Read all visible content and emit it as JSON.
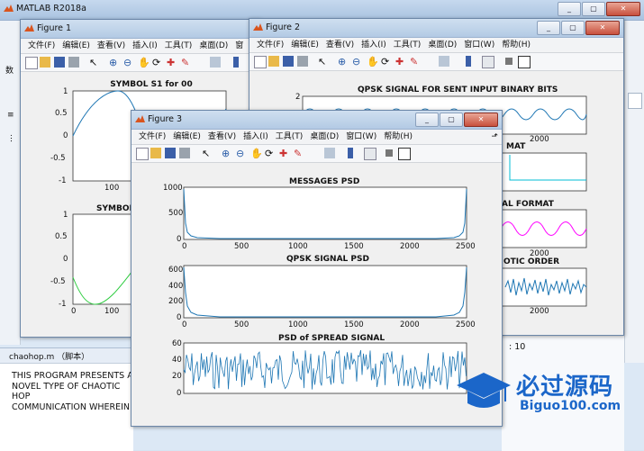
{
  "matlab": {
    "title": "MATLAB R2018a",
    "file_panel_title": "chaohop.m （脚本）",
    "file_text": [
      "THIS PROGRAM PRESENTS A",
      "NOVEL TYPE OF CHAOTIC HOP",
      "COMMUNICATION WHEREIN"
    ],
    "side_letter": "数",
    "right_value": ": 10"
  },
  "menus": {
    "fig1": [
      "文件(F)",
      "编辑(E)",
      "查看(V)",
      "插入(I)",
      "工具(T)",
      "桌面(D)",
      "窗"
    ],
    "fig2": [
      "文件(F)",
      "编辑(E)",
      "查看(V)",
      "插入(I)",
      "工具(T)",
      "桌面(D)",
      "窗口(W)",
      "帮助(H)"
    ],
    "fig3": [
      "文件(F)",
      "编辑(E)",
      "查看(V)",
      "插入(I)",
      "工具(T)",
      "桌面(D)",
      "窗口(W)",
      "帮助(H)"
    ]
  },
  "fig1": {
    "title": "Figure 1",
    "plot1": {
      "title": "SYMBOL S1 for 00",
      "yticks": [
        "1",
        "0.5",
        "0",
        "-0.5",
        "-1"
      ],
      "xticks": [
        "100"
      ]
    },
    "plot2": {
      "title": "SYMBOL",
      "yticks": [
        "1",
        "0.5",
        "0",
        "-0.5",
        "-1"
      ],
      "xticks": [
        "0",
        "100"
      ]
    }
  },
  "fig2": {
    "title": "Figure 2",
    "plot1": {
      "title": "QPSK SIGNAL FOR SENT INPUT BINARY BITS",
      "ytick": "2",
      "xtick": "2000"
    },
    "plot2": {
      "title": "MAT"
    },
    "plot3": {
      "title": "AL FORMAT",
      "xtick": "2000"
    },
    "plot4": {
      "title": "OTIC ORDER",
      "xtick": "2000"
    }
  },
  "fig3": {
    "title": "Figure 3",
    "xticks": [
      "0",
      "500",
      "1000",
      "1500",
      "2000",
      "2500"
    ],
    "plot1": {
      "title": "MESSAGES PSD",
      "yticks": [
        "1000",
        "500",
        "0"
      ]
    },
    "plot2": {
      "title": "QPSK SIGNAL PSD",
      "yticks": [
        "600",
        "400",
        "200",
        "0"
      ]
    },
    "plot3": {
      "title": "PSD of SPREAD SIGNAL",
      "yticks": [
        "60",
        "40",
        "20",
        "0"
      ]
    }
  },
  "watermark": {
    "cn": "必过源码",
    "en": "Biguo100.com"
  },
  "colors": {
    "plot_blue": "#1f77b4",
    "plot_green": "#2ecc40",
    "plot_magenta": "#ff00ff",
    "plot_cyan": "#00bcd4",
    "watermark_blue": "#1b66c9"
  }
}
